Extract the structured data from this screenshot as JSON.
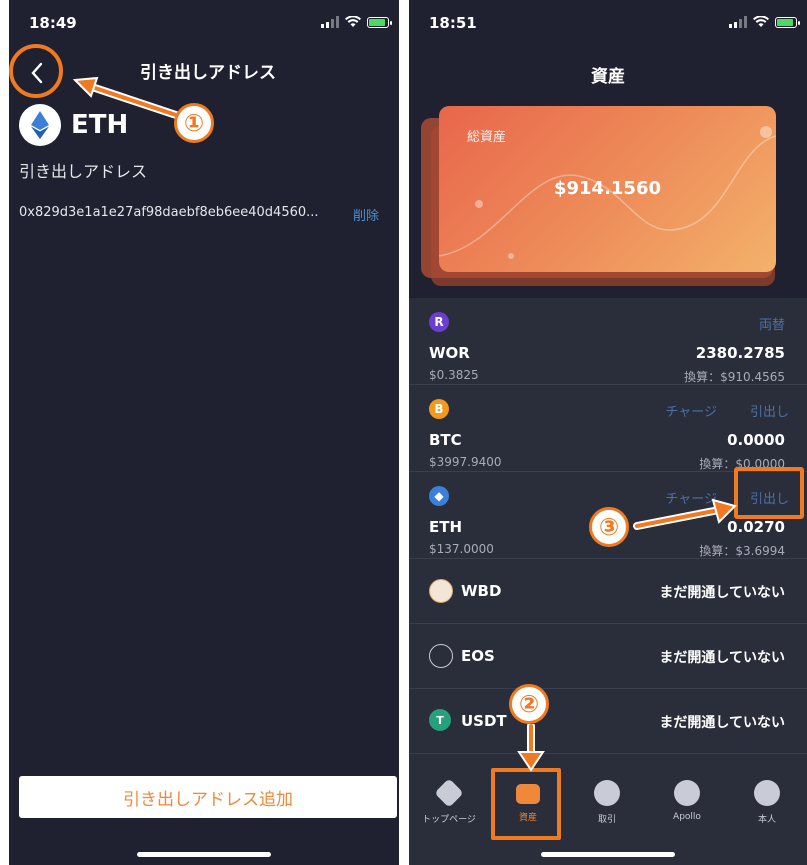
{
  "left": {
    "status_time": "18:49",
    "nav_title": "引き出しアドレス",
    "coin_name": "ETH",
    "section_label": "引き出しアドレス",
    "address": "0x829d3e1a1e27af98daebf8eb6ee40d4560...",
    "delete_label": "削除",
    "add_button": "引き出しアドレス追加",
    "annotation_number": "①"
  },
  "right": {
    "status_time": "18:51",
    "title": "資産",
    "card": {
      "label": "総資産",
      "value": "$914.1560"
    },
    "assets": [
      {
        "icon": "R",
        "icon_color": "#6a3fd0",
        "actions": [
          "両替"
        ],
        "name": "WOR",
        "amount": "2380.2785",
        "price": "$0.3825",
        "converted": "換算：$910.4565"
      },
      {
        "icon": "B",
        "icon_color": "#f39a1e",
        "actions": [
          "チャージ",
          "引出し"
        ],
        "name": "BTC",
        "amount": "0.0000",
        "price": "$3997.9400",
        "converted": "換算：$0.0000"
      },
      {
        "icon": "◆",
        "icon_color": "#3b7fd9",
        "actions": [
          "チャージ",
          "引出し"
        ],
        "name": "ETH",
        "amount": "0.0270",
        "price": "$137.0000",
        "converted": "換算：$3.6994"
      }
    ],
    "inactive": [
      {
        "name": "WBD",
        "status": "まだ開通していない",
        "icon_color": "#f4e6d6"
      },
      {
        "name": "EOS",
        "status": "まだ開通していない",
        "icon_color": "#2a2d3a"
      },
      {
        "name": "USDT",
        "status": "まだ開通していない",
        "icon_color": "#26a17b"
      }
    ],
    "tabs": [
      "トップページ",
      "資産",
      "取引",
      "Apollo",
      "本人"
    ],
    "annotation_2": "②",
    "annotation_3": "③"
  }
}
